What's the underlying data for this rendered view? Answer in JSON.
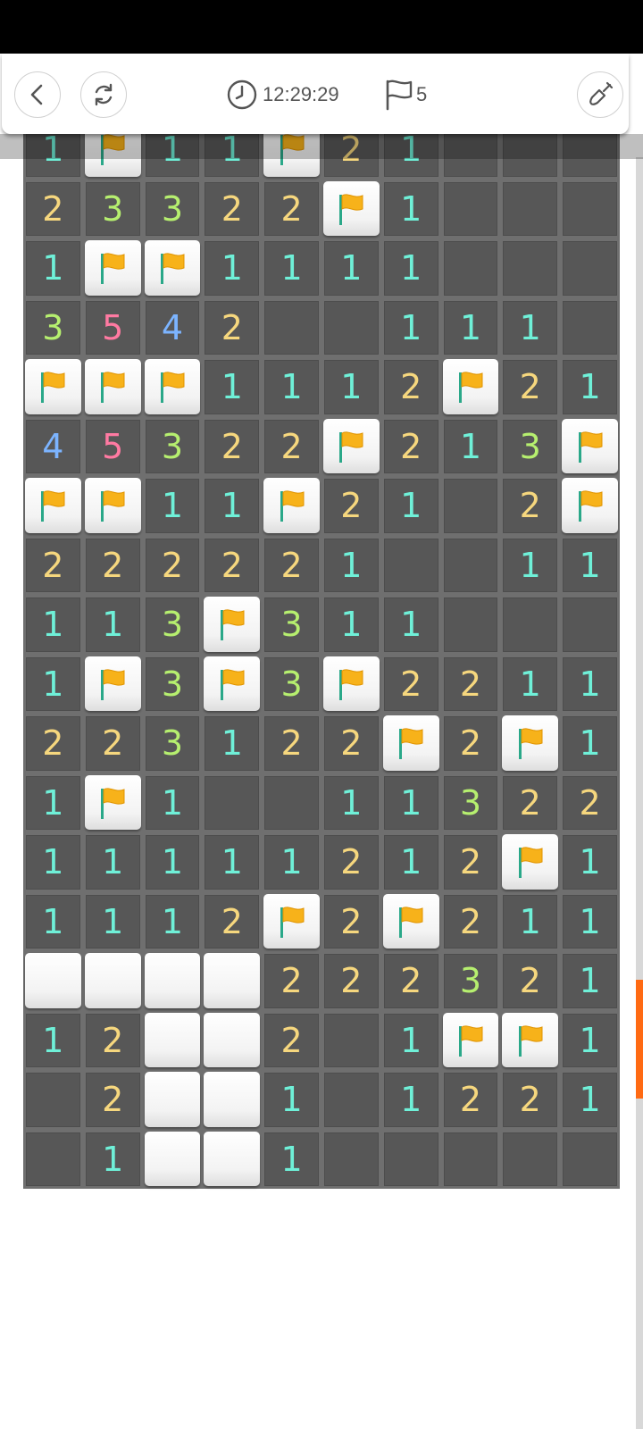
{
  "header": {
    "timer": "12:29:29",
    "flag_count": "5",
    "icons": {
      "back": "back-arrow-icon",
      "restart": "refresh-icon",
      "timer": "clock-icon",
      "flags": "flag-outline-icon",
      "tool": "shovel-icon"
    }
  },
  "colors": {
    "number_1": "#6ff0d8",
    "number_2": "#f6d77e",
    "number_3": "#b6ef6f",
    "number_4": "#7cb4ff",
    "number_5": "#ff7aa2",
    "flag": "#f7b21a",
    "scroll_thumb": "#ff6a13"
  },
  "board": {
    "columns": 10,
    "legend": "digits = revealed count, F = flagged, C = covered, . = empty revealed",
    "rows": [
      [
        "1",
        "F",
        "1",
        "1",
        "F",
        "2",
        "1",
        ".",
        ".",
        "."
      ],
      [
        "2",
        "3",
        "3",
        "2",
        "2",
        "F",
        "1",
        ".",
        ".",
        "."
      ],
      [
        "1",
        "F",
        "F",
        "1",
        "1",
        "1",
        "1",
        ".",
        ".",
        "."
      ],
      [
        "3",
        "5",
        "4",
        "2",
        ".",
        ".",
        "1",
        "1",
        "1",
        "."
      ],
      [
        "F",
        "F",
        "F",
        "1",
        "1",
        "1",
        "2",
        "F",
        "2",
        "1"
      ],
      [
        "4",
        "5",
        "3",
        "2",
        "2",
        "F",
        "2",
        "1",
        "3",
        "F"
      ],
      [
        "F",
        "F",
        "1",
        "1",
        "F",
        "2",
        "1",
        ".",
        "2",
        "F"
      ],
      [
        "2",
        "2",
        "2",
        "2",
        "2",
        "1",
        ".",
        ".",
        "1",
        "1"
      ],
      [
        "1",
        "1",
        "3",
        "F",
        "3",
        "1",
        "1",
        ".",
        ".",
        "."
      ],
      [
        "1",
        "F",
        "3",
        "F",
        "3",
        "F",
        "2",
        "2",
        "1",
        "1"
      ],
      [
        "2",
        "2",
        "3",
        "1",
        "2",
        "2",
        "F",
        "2",
        "F",
        "1"
      ],
      [
        "1",
        "F",
        "1",
        ".",
        ".",
        "1",
        "1",
        "3",
        "2",
        "2"
      ],
      [
        "1",
        "1",
        "1",
        "1",
        "1",
        "2",
        "1",
        "2",
        "F",
        "1"
      ],
      [
        "1",
        "1",
        "1",
        "2",
        "F",
        "2",
        "F",
        "2",
        "1",
        "1"
      ],
      [
        "C",
        "C",
        "C",
        "C",
        "2",
        "2",
        "2",
        "3",
        "2",
        "1"
      ],
      [
        "1",
        "2",
        "C",
        "C",
        "2",
        ".",
        "1",
        "F",
        "F",
        "1"
      ],
      [
        ".",
        "2",
        "C",
        "C",
        "1",
        ".",
        "1",
        "2",
        "2",
        "1"
      ],
      [
        ".",
        "1",
        "C",
        "C",
        "1",
        ".",
        ".",
        ".",
        ".",
        "."
      ]
    ]
  }
}
